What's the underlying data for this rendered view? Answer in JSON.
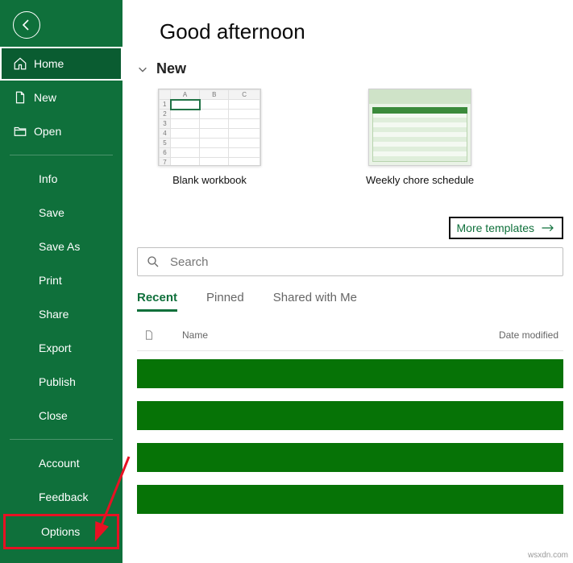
{
  "sidebar": {
    "items": [
      {
        "label": "Home",
        "icon": "home-icon",
        "type": "main",
        "selected": true
      },
      {
        "label": "New",
        "icon": "new-icon",
        "type": "main"
      },
      {
        "label": "Open",
        "icon": "open-icon",
        "type": "main"
      }
    ],
    "subs_group1": [
      {
        "label": "Info"
      },
      {
        "label": "Save"
      },
      {
        "label": "Save As"
      },
      {
        "label": "Print"
      },
      {
        "label": "Share"
      },
      {
        "label": "Export"
      },
      {
        "label": "Publish"
      },
      {
        "label": "Close"
      }
    ],
    "subs_group2": [
      {
        "label": "Account"
      },
      {
        "label": "Feedback"
      },
      {
        "label": "Options"
      }
    ]
  },
  "main": {
    "title": "Good afternoon",
    "new_section": "New",
    "templates": [
      {
        "label": "Blank workbook",
        "kind": "blank"
      },
      {
        "label": "Weekly chore schedule",
        "kind": "chore"
      }
    ],
    "more_templates": "More templates",
    "search_placeholder": "Search",
    "tabs": [
      {
        "label": "Recent",
        "active": true
      },
      {
        "label": "Pinned"
      },
      {
        "label": "Shared with Me"
      }
    ],
    "columns": {
      "name": "Name",
      "date": "Date modified"
    },
    "redacted_rows": 4
  },
  "watermark": "wsxdn.com"
}
